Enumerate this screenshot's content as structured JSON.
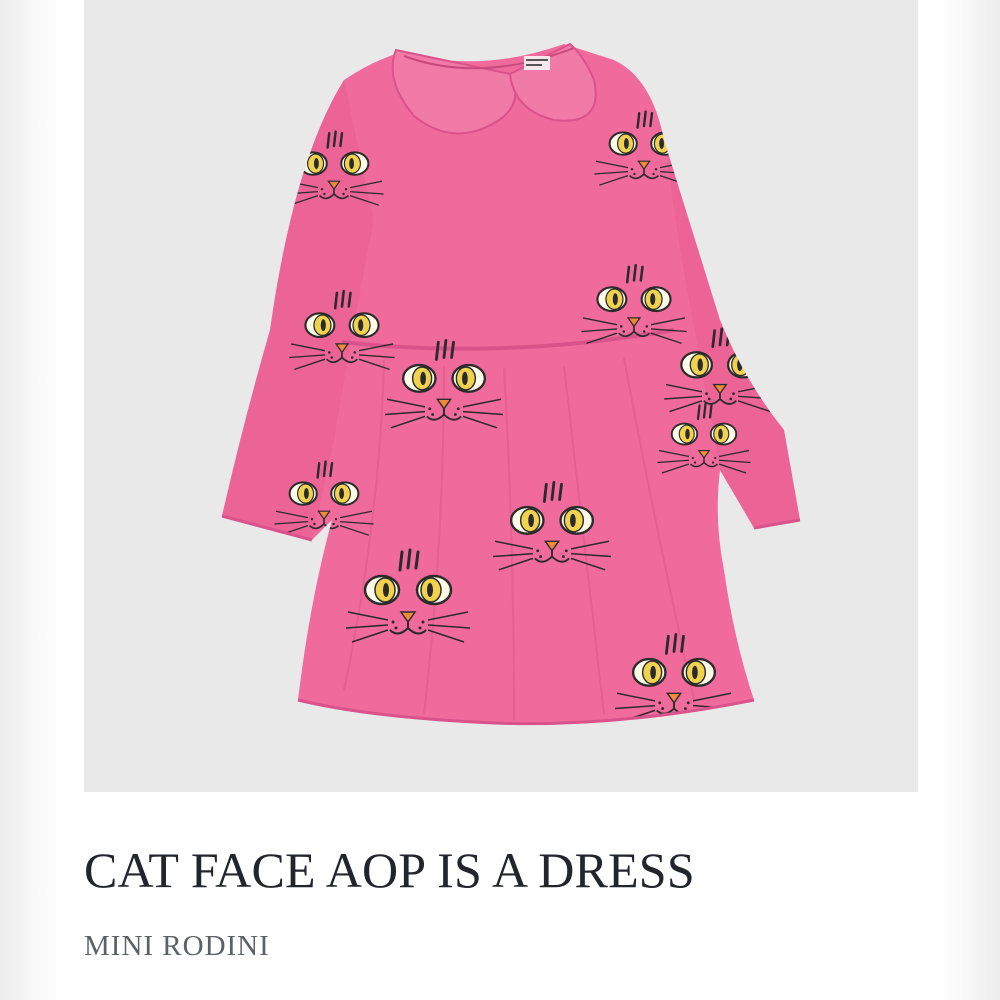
{
  "product": {
    "title": "CAT FACE AOP IS A DRESS",
    "brand": "MINI RODINI",
    "image": {
      "subject": "dress-illustration",
      "colors": {
        "background": "#e9e9ea",
        "fabric": "#f06b9c",
        "fabric_shadow": "#e45a8d",
        "eye": "#f1d24e",
        "nose": "#f08a3a",
        "line": "#2b2b2b"
      }
    }
  }
}
